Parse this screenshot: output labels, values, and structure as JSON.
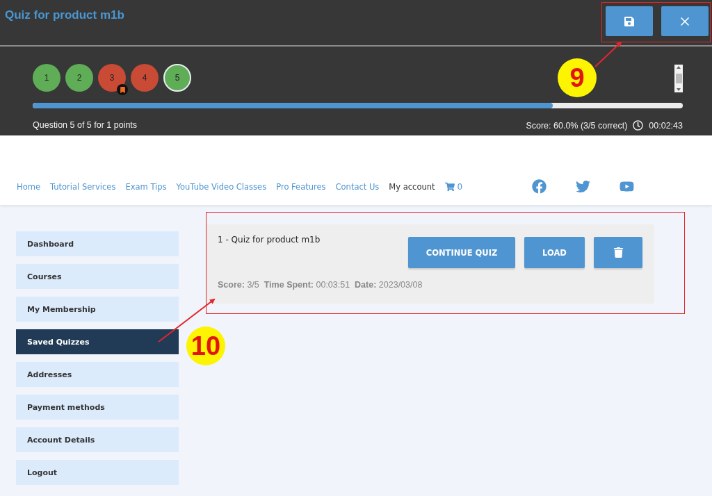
{
  "quiz_header": {
    "title": "Quiz for product m1b"
  },
  "question_dots": [
    {
      "label": "1",
      "color": "#5fad56",
      "selected": false,
      "bookmarked": false
    },
    {
      "label": "2",
      "color": "#5fad56",
      "selected": false,
      "bookmarked": false
    },
    {
      "label": "3",
      "color": "#c94a35",
      "selected": false,
      "bookmarked": true
    },
    {
      "label": "4",
      "color": "#c94a35",
      "selected": false,
      "bookmarked": false
    },
    {
      "label": "5",
      "color": "#5fad56",
      "selected": true,
      "bookmarked": false
    }
  ],
  "progress": {
    "level": 0.8
  },
  "question_info": "Question 5 of 5 for 1 points",
  "score": "Score: 60.0% (3/5 correct)",
  "timer": "00:02:43",
  "nav": {
    "links": [
      {
        "label": "Home",
        "selected": false
      },
      {
        "label": "Tutorial Services",
        "selected": false
      },
      {
        "label": "Exam Tips",
        "selected": false
      },
      {
        "label": "YouTube Video Classes",
        "selected": false
      },
      {
        "label": "Pro Features",
        "selected": false
      },
      {
        "label": "Contact Us",
        "selected": false
      },
      {
        "label": "My account",
        "selected": true
      }
    ],
    "cart_count": "0"
  },
  "sidebar": {
    "items": [
      {
        "label": "Dashboard",
        "selected": false
      },
      {
        "label": "Courses",
        "selected": false
      },
      {
        "label": "My Membership",
        "selected": false
      },
      {
        "label": "Saved Quizzes",
        "selected": true
      },
      {
        "label": "Addresses",
        "selected": false
      },
      {
        "label": "Payment methods",
        "selected": false
      },
      {
        "label": "Account Details",
        "selected": false
      },
      {
        "label": "Logout",
        "selected": false
      }
    ]
  },
  "saved_quizzes": [
    {
      "title": "1 - Quiz for product m1b",
      "meta": "**Score:** 3/5  **Time Spent:** 00:03:51  **Date:** 2023/03/08",
      "buttons": [
        "CONTINUE QUIZ",
        "LOAD"
      ]
    }
  ],
  "annotations": [
    "9",
    "10"
  ]
}
